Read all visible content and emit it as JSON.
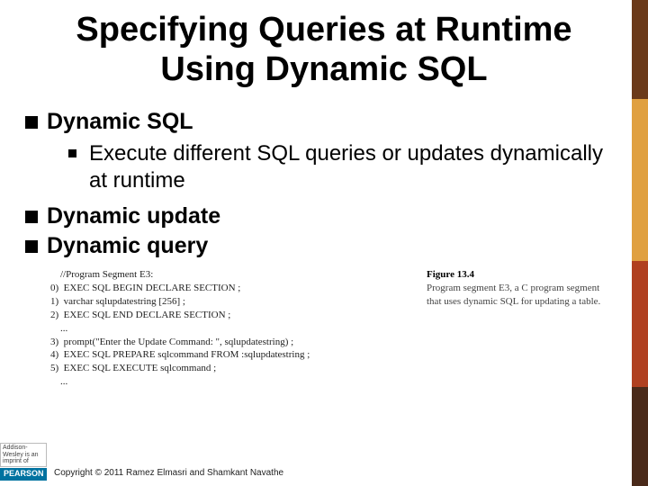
{
  "title": "Specifying Queries at Runtime Using Dynamic SQL",
  "bullets": {
    "b1": "Dynamic SQL",
    "b1_sub": "Execute different SQL queries or updates dynamically at runtime",
    "b2": "Dynamic update",
    "b3": "Dynamic query"
  },
  "figure": {
    "label": "Figure 13.4",
    "caption": "Program segment E3, a C program segment that uses dynamic SQL for updating a table.",
    "code": "    //Program Segment E3:\n0)  EXEC SQL BEGIN DECLARE SECTION ;\n1)  varchar sqlupdatestring [256] ;\n2)  EXEC SQL END DECLARE SECTION ;\n    ...\n3)  prompt(\"Enter the Update Command: \", sqlupdatestring) ;\n4)  EXEC SQL PREPARE sqlcommand FROM :sqlupdatestring ;\n5)  EXEC SQL EXECUTE sqlcommand ;\n    ..."
  },
  "footer": {
    "logo_top": "Addison-Wesley is an imprint of",
    "logo_main": "PEARSON",
    "copyright": "Copyright © 2011 Ramez Elmasri and Shamkant Navathe"
  }
}
